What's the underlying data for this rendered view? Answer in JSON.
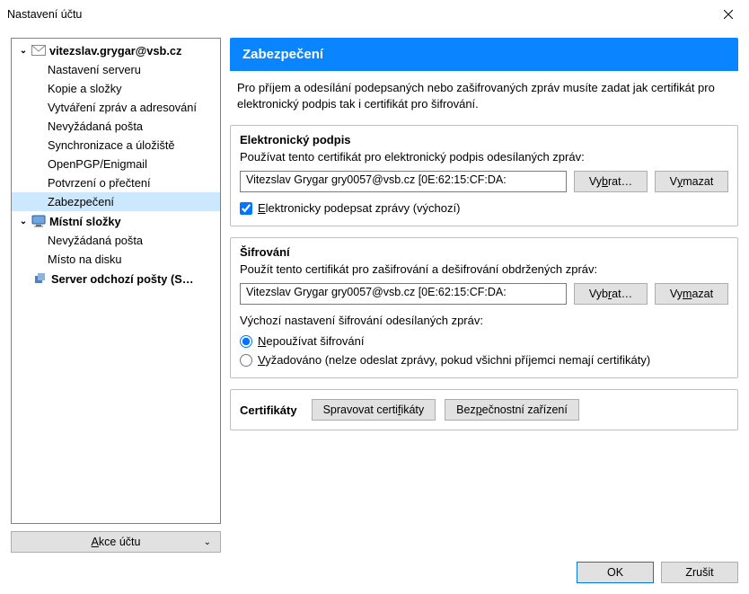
{
  "window": {
    "title": "Nastavení účtu"
  },
  "sidebar": {
    "accounts": [
      {
        "label": "vitezslav.grygar@vsb.cz",
        "items": [
          {
            "label": "Nastavení serveru"
          },
          {
            "label": "Kopie a složky"
          },
          {
            "label": "Vytváření zpráv a adresování"
          },
          {
            "label": "Nevyžádaná pošta"
          },
          {
            "label": "Synchronizace a úložiště"
          },
          {
            "label": "OpenPGP/Enigmail"
          },
          {
            "label": "Potvrzení o přečtení"
          },
          {
            "label": "Zabezpečení",
            "selected": true
          }
        ]
      },
      {
        "label": "Místní složky",
        "items": [
          {
            "label": "Nevyžádaná pošta"
          },
          {
            "label": "Místo na disku"
          }
        ]
      }
    ],
    "outgoing_label": "Server odchozí pošty (S…",
    "action_button": "Akce účtu"
  },
  "main": {
    "banner": "Zabezpečení",
    "intro": "Pro příjem a odesílání podepsaných nebo zašifrovaných zpráv musíte zadat jak certifikát pro elektronický podpis tak i certifikát pro šifrování.",
    "sign": {
      "heading": "Elektronický podpis",
      "desc": "Používat tento certifikát pro elektronický podpis odesílaných zpráv:",
      "cert_value": "Vitezslav Grygar gry0057@vsb.cz [0E:62:15:CF:DA:",
      "select_label": "Vybrat…",
      "clear_label": "Vymazat",
      "checkbox_label": "Elektronicky podepsat zprávy (výchozí)",
      "checked": true
    },
    "enc": {
      "heading": "Šifrování",
      "desc": "Použít tento certifikát pro zašifrování a dešifrování obdržených zpráv:",
      "cert_value": "Vitezslav Grygar gry0057@vsb.cz [0E:62:15:CF:DA:",
      "select_label": "Vybrat…",
      "clear_label": "Vymazat",
      "default_label": "Výchozí nastavení šifrování odesílaných zpráv:",
      "radio_none": "Nepoužívat šifrování",
      "radio_required": "Vyžadováno (nelze odeslat zprávy, pokud všichni příjemci nemají certifikáty)",
      "radio_value": "none"
    },
    "certs": {
      "label": "Certifikáty",
      "manage": "Spravovat certifikáty",
      "devices": "Bezpečnostní zařízení"
    }
  },
  "footer": {
    "ok": "OK",
    "cancel": "Zrušit"
  }
}
